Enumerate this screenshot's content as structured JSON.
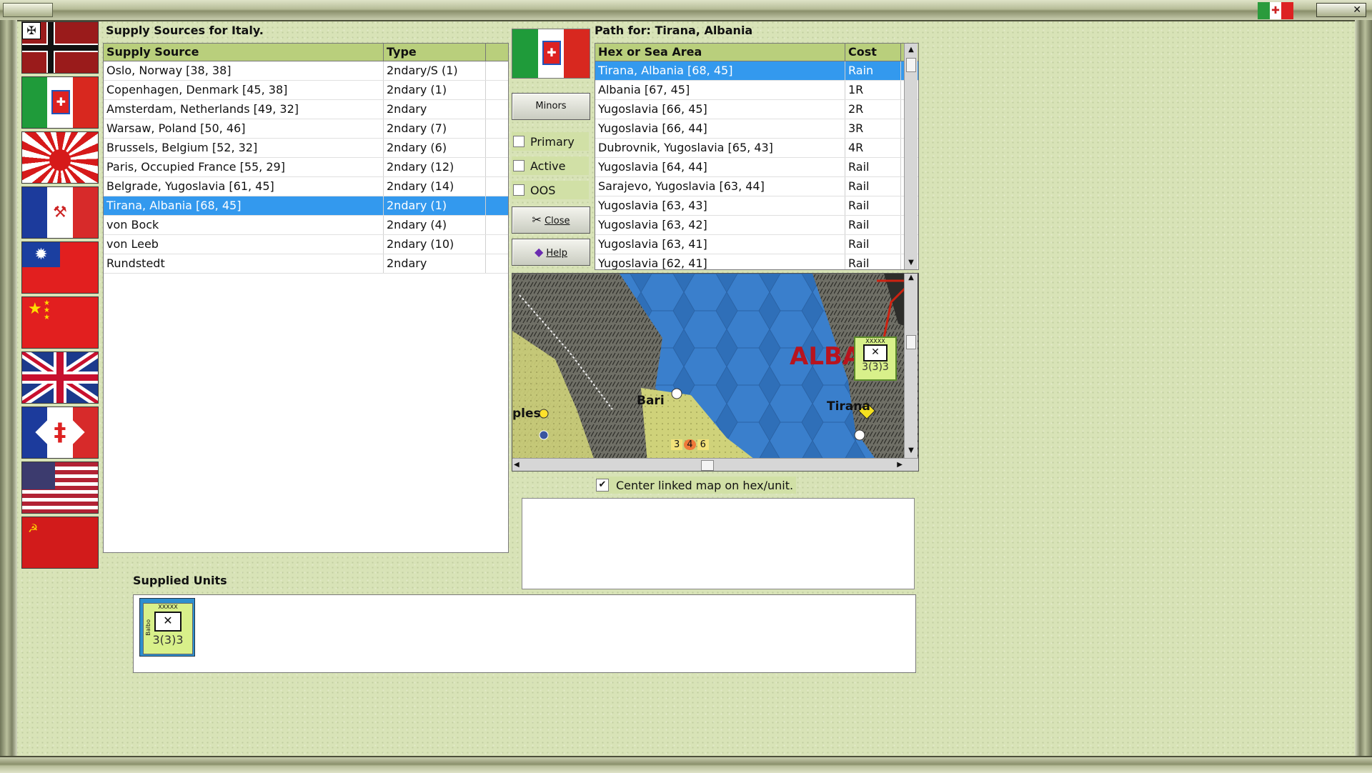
{
  "supply_panel": {
    "title": "Supply Sources for Italy.",
    "columns": [
      "Supply Source",
      "Type"
    ],
    "rows": [
      {
        "source": "Oslo, Norway [38, 38]",
        "type": "2ndary/S (1)"
      },
      {
        "source": "Copenhagen, Denmark [45, 38]",
        "type": "2ndary (1)"
      },
      {
        "source": "Amsterdam, Netherlands [49, 32]",
        "type": "2ndary"
      },
      {
        "source": "Warsaw, Poland [50, 46]",
        "type": "2ndary (7)"
      },
      {
        "source": "Brussels, Belgium [52, 32]",
        "type": "2ndary (6)"
      },
      {
        "source": "Paris, Occupied France [55, 29]",
        "type": "2ndary (12)"
      },
      {
        "source": "Belgrade, Yugoslavia [61, 45]",
        "type": "2ndary (14)"
      },
      {
        "source": "Tirana, Albania [68, 45]",
        "type": "2ndary (1)",
        "selected": true
      },
      {
        "source": "von Bock",
        "type": "2ndary (4)"
      },
      {
        "source": "von Leeb",
        "type": "2ndary (10)"
      },
      {
        "source": "Rundstedt",
        "type": "2ndary"
      }
    ]
  },
  "controls": {
    "minors_label": "Minors",
    "primary_label": "Primary",
    "active_label": "Active",
    "oos_label": "OOS",
    "close_label": "Close",
    "help_label": "Help"
  },
  "path_panel": {
    "title": "Path for: Tirana, Albania",
    "columns": [
      "Hex or Sea Area",
      "Cost"
    ],
    "rows": [
      {
        "hex": "Tirana, Albania [68, 45]",
        "cost": "Rain",
        "selected": true
      },
      {
        "hex": "Albania [67, 45]",
        "cost": "1R"
      },
      {
        "hex": "Yugoslavia [66, 45]",
        "cost": "2R"
      },
      {
        "hex": "Yugoslavia [66, 44]",
        "cost": "3R"
      },
      {
        "hex": "Dubrovnik, Yugoslavia [65, 43]",
        "cost": "4R"
      },
      {
        "hex": "Yugoslavia [64, 44]",
        "cost": "Rail"
      },
      {
        "hex": "Sarajevo, Yugoslavia [63, 44]",
        "cost": "Rail"
      },
      {
        "hex": "Yugoslavia [63, 43]",
        "cost": "Rail"
      },
      {
        "hex": "Yugoslavia [63, 42]",
        "cost": "Rail"
      },
      {
        "hex": "Yugoslavia [63, 41]",
        "cost": "Rail"
      },
      {
        "hex": "Yugoslavia [62, 41]",
        "cost": "Rail"
      }
    ]
  },
  "map": {
    "labels": {
      "albania": "ALBA",
      "bari": "Bari",
      "tirana": "Tirana",
      "naples": "ples"
    },
    "unit_strength": "3(3)3",
    "unit_size": "XXXXX",
    "stack": [
      "3",
      "4",
      "6"
    ]
  },
  "center_option": {
    "label": "Center linked map on hex/unit.",
    "checked": true
  },
  "supplied_units": {
    "title": "Supplied Units",
    "units": [
      {
        "strength": "3(3)3",
        "size": "XXXXX",
        "name": "Balbo"
      }
    ]
  },
  "flags": [
    "germany",
    "italy",
    "japan",
    "vichy-france",
    "nationalist-china",
    "communist-china",
    "united-kingdom",
    "free-france",
    "united-states",
    "soviet-union"
  ],
  "colors": {
    "selection": "#3399ee",
    "header": "#b9cf7c",
    "background": "#d8e3b7"
  }
}
